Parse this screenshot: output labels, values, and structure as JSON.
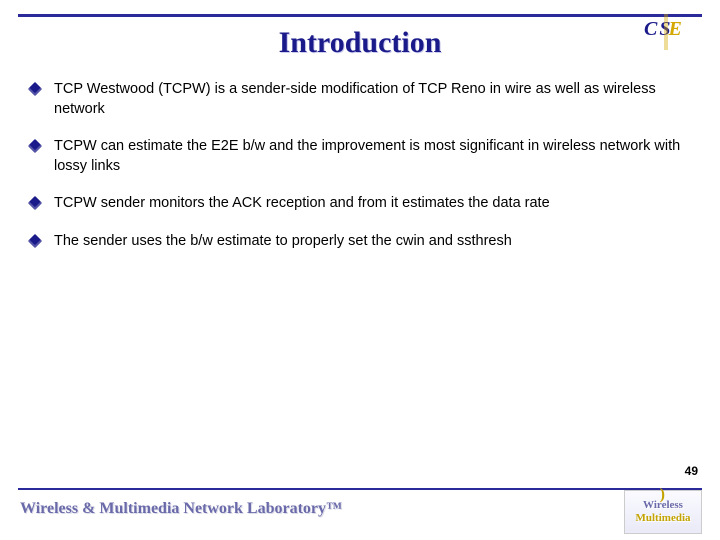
{
  "slide": {
    "title": "Introduction",
    "page_number": "49",
    "top_logo": {
      "left": "CS",
      "right": "E"
    },
    "footer": {
      "text": "Wireless & Multimedia Network Laboratory™",
      "logo_line1": "Wireless",
      "logo_line2": "Multimedia"
    },
    "bullets": [
      "TCP Westwood (TCPW) is a sender-side modification of TCP Reno in wire as well as wireless network",
      "TCPW can estimate the E2E b/w and the improvement is most significant in wireless network with lossy links",
      "TCPW sender monitors the ACK reception and from it estimates the data rate",
      "The sender uses the b/w estimate to properly set the cwin and ssthresh"
    ]
  }
}
